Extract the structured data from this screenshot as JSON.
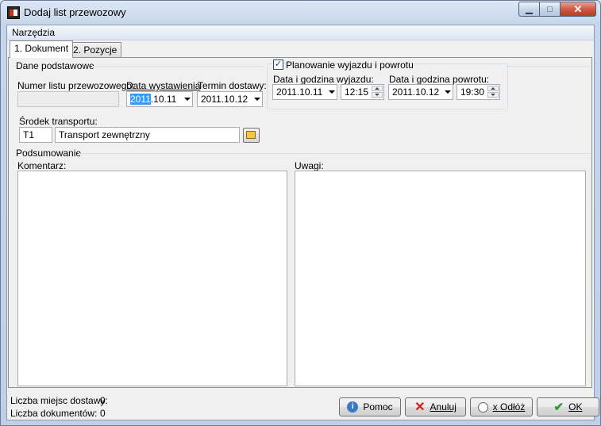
{
  "window": {
    "title": "Dodaj list przewozowy",
    "min_glyph": "▁",
    "max_glyph": "□",
    "close_glyph": "✕"
  },
  "menu": {
    "tools": "Narzędzia"
  },
  "tabs": [
    {
      "label": "1. Dokument",
      "active": true
    },
    {
      "label": "2. Pozycje",
      "active": false
    }
  ],
  "basic": {
    "group_title": "Dane podstawowe",
    "doc_number_label": "Numer listu przewozowego:",
    "doc_number_value": "",
    "issue_date_label": "Data wystawienia",
    "issue_date_sel": "2011",
    "issue_date_rest": ".10.11",
    "delivery_date_label": "Termin dostawy:",
    "delivery_date_value": "2011.10.12",
    "plan_label": "Planowanie wyjazdu i powrotu",
    "plan_checked": "✓",
    "departure_label": "Data i godzina wyjazdu:",
    "departure_date": "2011.10.11",
    "departure_time": "12:15",
    "return_label": "Data i godzina powrotu:",
    "return_date": "2011.10.12",
    "return_time": "19:30",
    "transport_label": "Środek transportu:",
    "transport_code": "T1",
    "transport_name": "Transport zewnętrzny"
  },
  "summary": {
    "group_title": "Podsumowanie",
    "comment_label": "Komentarz:",
    "notes_label": "Uwagi:",
    "comment_value": "",
    "notes_value": ""
  },
  "status": {
    "places_label": "Liczba miejsc dostawy:",
    "places_value": "0",
    "docs_label": "Liczba dokumentów:",
    "docs_value": "0"
  },
  "buttons": {
    "help": "Pomoc",
    "cancel": "Anuluj",
    "defer": "x Odłóż",
    "ok": "OK"
  }
}
